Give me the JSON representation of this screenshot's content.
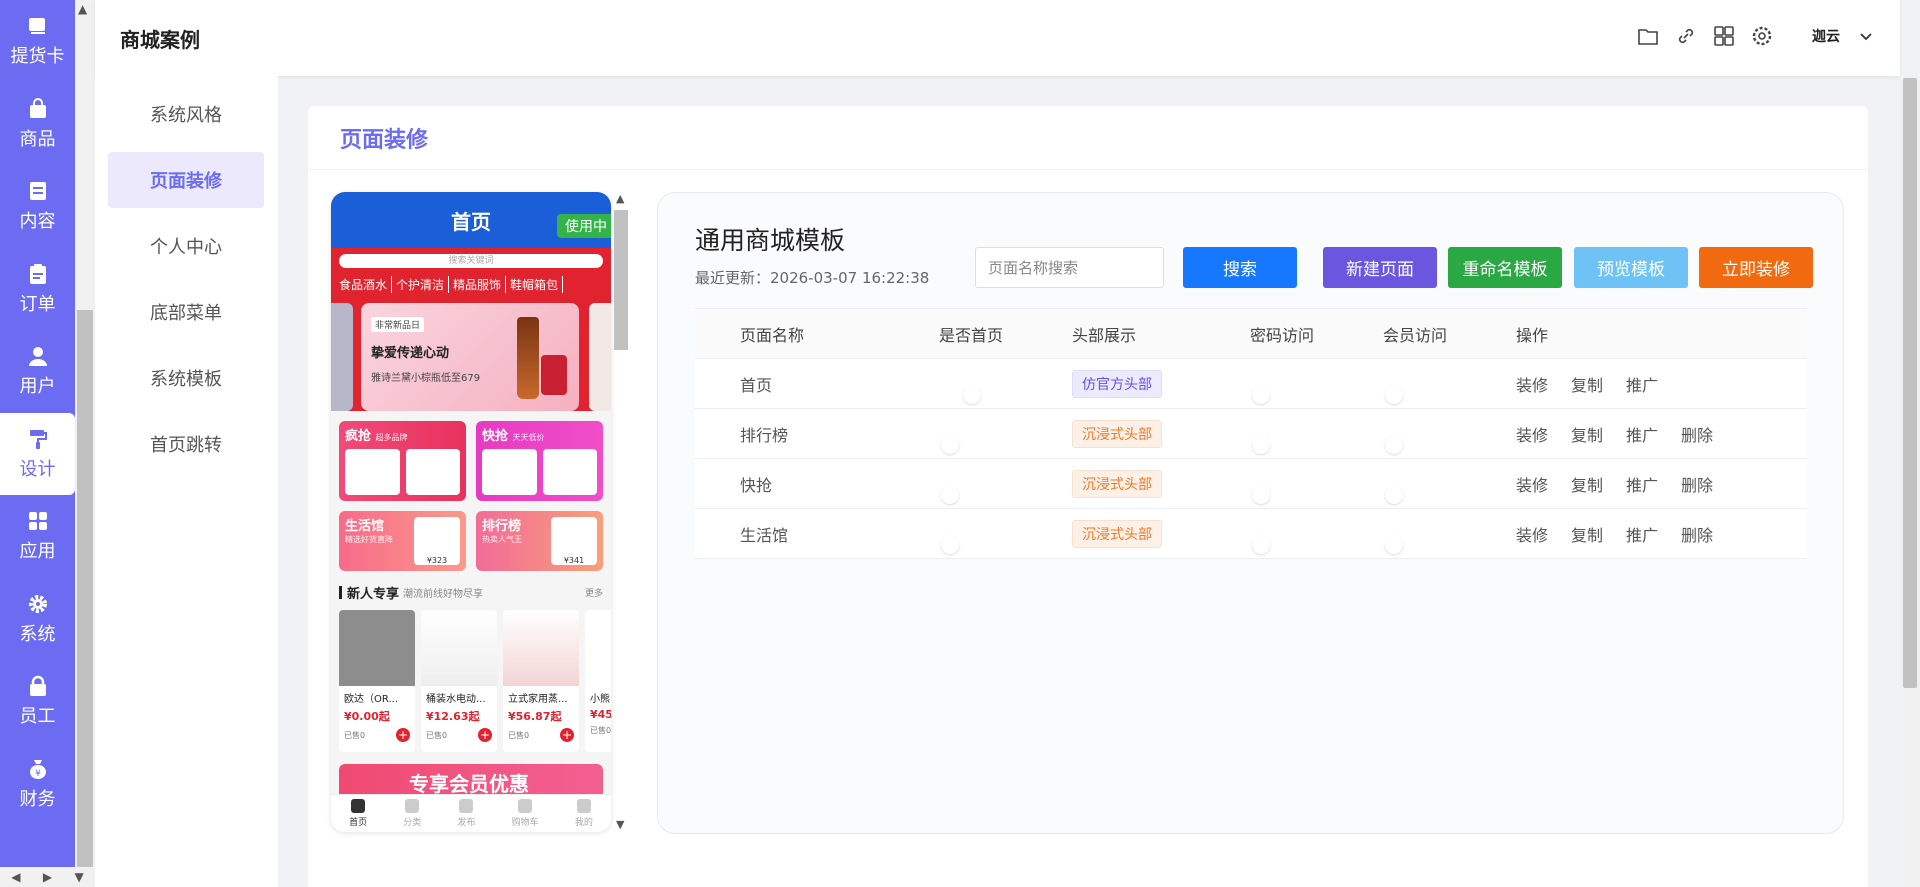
{
  "rail": {
    "items": [
      {
        "label": "提货卡",
        "icon": "card-icon"
      },
      {
        "label": "商品",
        "icon": "bag-icon"
      },
      {
        "label": "内容",
        "icon": "document-icon"
      },
      {
        "label": "订单",
        "icon": "clipboard-icon"
      },
      {
        "label": "用户",
        "icon": "user-icon"
      },
      {
        "label": "设计",
        "icon": "paint-roller-icon"
      },
      {
        "label": "应用",
        "icon": "grid-icon"
      },
      {
        "label": "系统",
        "icon": "gear-icon"
      },
      {
        "label": "员工",
        "icon": "lock-icon"
      },
      {
        "label": "财务",
        "icon": "money-bag-icon"
      }
    ],
    "active": "设计"
  },
  "header": {
    "title": "商城案例",
    "user": "迦云"
  },
  "submenu": {
    "items": [
      "系统风格",
      "页面装修",
      "个人中心",
      "底部菜单",
      "系统模板",
      "首页跳转"
    ],
    "active": "页面装修"
  },
  "card": {
    "title": "页面装修"
  },
  "phone": {
    "header_title": "首页",
    "in_use_badge": "使用中",
    "search_placeholder": "搜索关键词",
    "categories": [
      "食品酒水",
      "个护清洁",
      "精品服饰",
      "鞋帽箱包"
    ],
    "banner": {
      "tag": "非常新品日",
      "headline": "挚爱传递心动",
      "subline": "雅诗兰黛小棕瓶低至679"
    },
    "promos": [
      {
        "title": "疯抢",
        "sub": "超多品牌"
      },
      {
        "title": "快抢",
        "sub": "天天低价"
      },
      {
        "title": "生活馆",
        "sub": "精选好货直降",
        "price": "¥323"
      },
      {
        "title": "排行榜",
        "sub": "热卖人气王",
        "price": "¥341"
      }
    ],
    "new_section": {
      "title": "新人专享",
      "subtitle": "潮流前线好物尽享",
      "more": "更多"
    },
    "goods": [
      {
        "name": "欧达（OR...",
        "price": "¥0.00起",
        "sold": "已售0"
      },
      {
        "name": "桶装水电动...",
        "price": "¥12.63起",
        "sold": "已售0"
      },
      {
        "name": "立式家用蒸...",
        "price": "¥56.87起",
        "sold": "已售0"
      },
      {
        "name": "小熊...",
        "price": "¥45",
        "sold": "已售0"
      }
    ],
    "vip_text": "专享会员优惠",
    "nav": [
      "首页",
      "分类",
      "发布",
      "购物车",
      "我的"
    ]
  },
  "panel": {
    "title": "通用商城模板",
    "updated": "最近更新：2026-03-07 16:22:38",
    "search_placeholder": "页面名称搜索",
    "buttons": {
      "search": "搜索",
      "new_page": "新建页面",
      "rename": "重命名模板",
      "preview": "预览模板",
      "decorate": "立即装修"
    },
    "columns": [
      "页面名称",
      "是否首页",
      "头部展示",
      "密码访问",
      "会员访问",
      "操作"
    ],
    "rows": [
      {
        "name": "首页",
        "is_home": true,
        "header": "仿官方头部",
        "header_type": "official",
        "password": false,
        "member": false,
        "actions": [
          "装修",
          "复制",
          "推广"
        ]
      },
      {
        "name": "排行榜",
        "is_home": false,
        "header": "沉浸式头部",
        "header_type": "immersive",
        "password": false,
        "member": false,
        "actions": [
          "装修",
          "复制",
          "推广",
          "删除"
        ]
      },
      {
        "name": "快抢",
        "is_home": false,
        "header": "沉浸式头部",
        "header_type": "immersive",
        "password": false,
        "member": false,
        "actions": [
          "装修",
          "复制",
          "推广",
          "删除"
        ]
      },
      {
        "name": "生活馆",
        "is_home": false,
        "header": "沉浸式头部",
        "header_type": "immersive",
        "password": false,
        "member": false,
        "actions": [
          "装修",
          "复制",
          "推广",
          "删除"
        ]
      }
    ]
  }
}
